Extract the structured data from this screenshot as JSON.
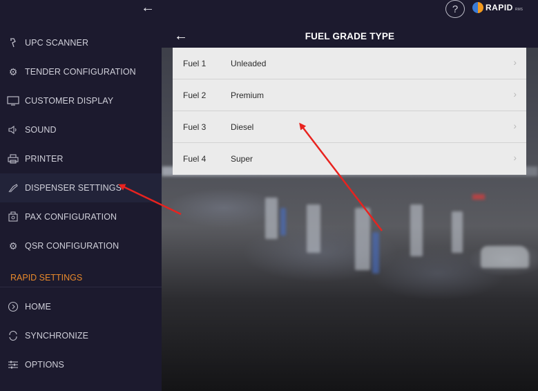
{
  "header": {
    "back_icon": "arrow-left-icon",
    "help_label": "?",
    "logo_text": "RAPID",
    "logo_sub": "RMS"
  },
  "sidebar": {
    "items": [
      {
        "label": "UPC SCANNER",
        "icon": "scanner-icon"
      },
      {
        "label": "TENDER CONFIGURATION",
        "icon": "gear-icon"
      },
      {
        "label": "CUSTOMER DISPLAY",
        "icon": "monitor-icon"
      },
      {
        "label": "SOUND",
        "icon": "speaker-icon"
      },
      {
        "label": "PRINTER",
        "icon": "printer-icon"
      },
      {
        "label": "DISPENSER SETTINGS",
        "icon": "fuel-nozzle-icon",
        "active": true
      },
      {
        "label": "PAX CONFIGURATION",
        "icon": "terminal-icon"
      },
      {
        "label": "QSR CONFIGURATION",
        "icon": "gear-icon"
      }
    ],
    "section_title": "RAPID SETTINGS",
    "section_items": [
      {
        "label": "HOME",
        "icon": "home-icon"
      },
      {
        "label": "SYNCHRONIZE",
        "icon": "sync-icon"
      },
      {
        "label": "OPTIONS",
        "icon": "sliders-icon"
      }
    ]
  },
  "main": {
    "title": "FUEL GRADE TYPE",
    "fuels": [
      {
        "number": "Fuel 1",
        "name": "Unleaded"
      },
      {
        "number": "Fuel 2",
        "name": "Premium"
      },
      {
        "number": "Fuel 3",
        "name": "Diesel"
      },
      {
        "number": "Fuel 4",
        "name": "Super"
      }
    ]
  },
  "colors": {
    "background": "#1c1a2e",
    "accent": "#e8892b",
    "annotation_arrow": "#e8231f",
    "list_bg": "#ebebeb"
  }
}
